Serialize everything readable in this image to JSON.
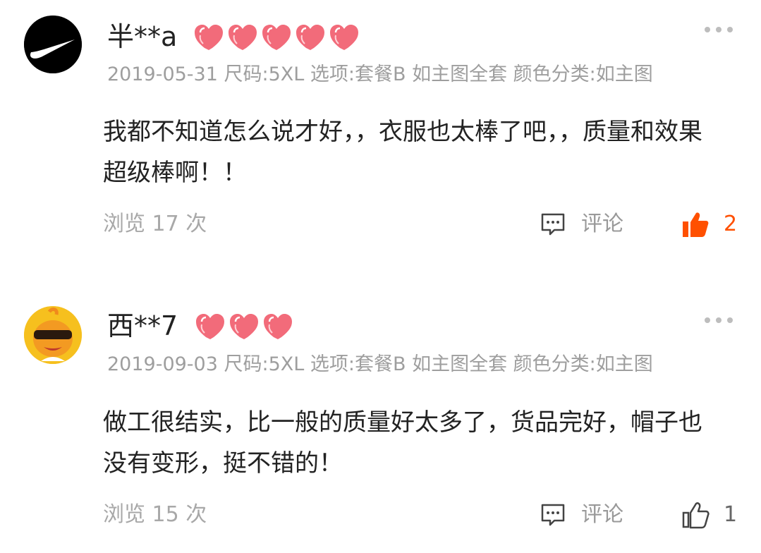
{
  "reviews": [
    {
      "username": "半**a",
      "hearts": 5,
      "meta": "2019-05-31 尺码:5XL 选项:套餐B 如主图全套 颜色分类:如主图",
      "content": "我都不知道怎么说才好，，衣服也太棒了吧，，质量和效果超级棒啊！！",
      "views": "浏览 17 次",
      "comment_label": "评论",
      "like_count": "2",
      "liked": true,
      "avatar": "nike-swoosh-avatar"
    },
    {
      "username": "西**7",
      "hearts": 3,
      "meta": "2019-09-03 尺码:5XL 选项:套餐B 如主图全套 颜色分类:如主图",
      "content": "做工很结实，比一般的质量好太多了，货品完好，帽子也没有变形，挺不错的！",
      "views": "浏览 15 次",
      "comment_label": "评论",
      "like_count": "1",
      "liked": false,
      "avatar": "cartoon-sunglasses-avatar"
    }
  ],
  "colors": {
    "accent": "#ff5000",
    "heart": "#f26b7a",
    "muted": "#9e9e9e"
  }
}
